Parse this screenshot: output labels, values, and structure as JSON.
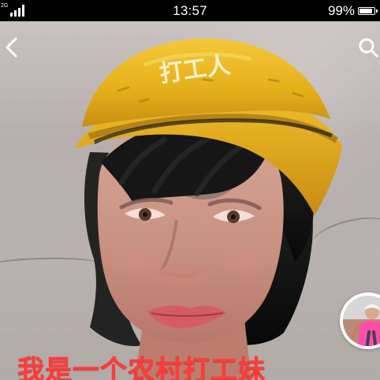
{
  "status_bar": {
    "network_tag": "2G",
    "time": "13:57",
    "battery_percent": "99%",
    "battery_level": 0.99,
    "icons": [
      "signal-icon",
      "battery-icon"
    ]
  },
  "video": {
    "helmet_text": "打工人",
    "caption": "我是一个农村打工妹"
  },
  "controls": {
    "left_icon": "back-arrow-icon",
    "right_icon": "search-icon",
    "avatar_icon": "profile-avatar-icon"
  },
  "colors": {
    "caption": "#ff3c39",
    "helmet": "#e9b51f",
    "status_bar": "#000000",
    "text_on_dark": "#ffffff"
  }
}
